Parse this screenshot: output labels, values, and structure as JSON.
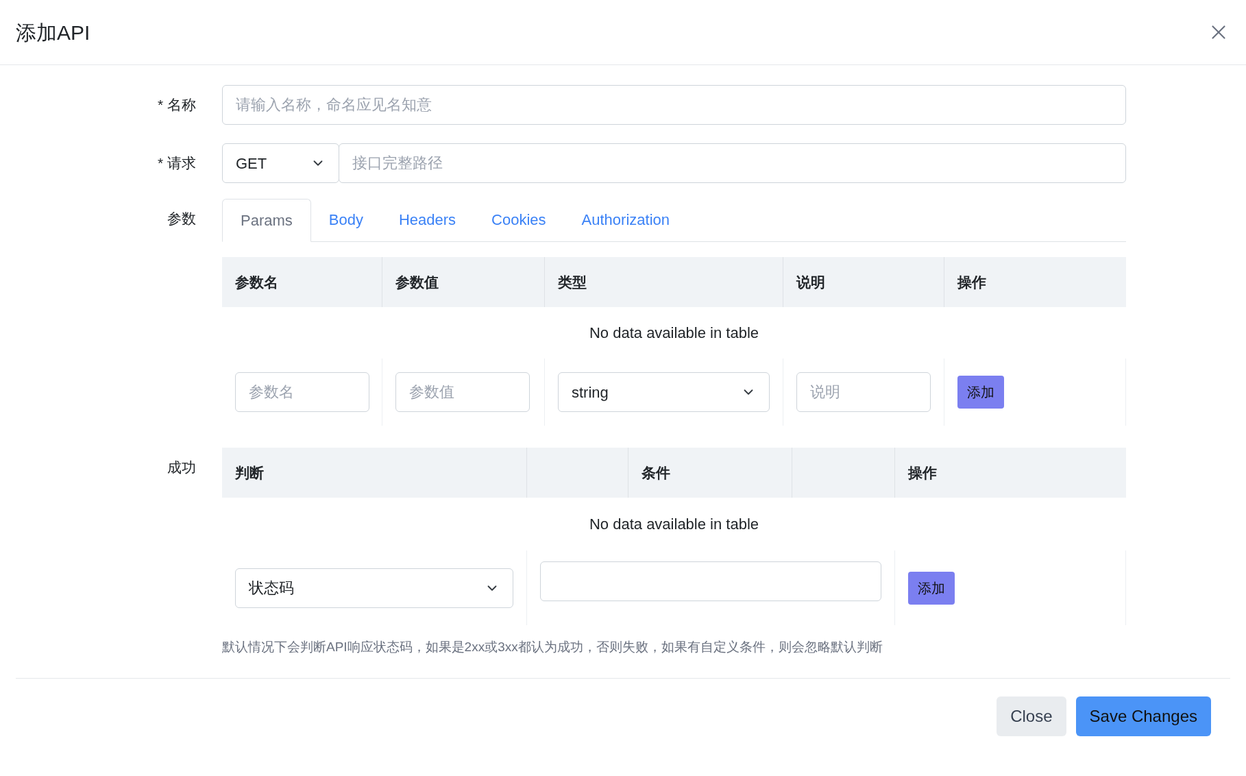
{
  "dialog": {
    "title": "添加API"
  },
  "form": {
    "name": {
      "label": "* 名称",
      "placeholder": "请输入名称，命名应见名知意"
    },
    "request": {
      "label": "* 请求",
      "method": "GET",
      "placeholder": "接口完整路径"
    },
    "params": {
      "label": "参数",
      "tabs": [
        {
          "label": "Params",
          "selected": true
        },
        {
          "label": "Body",
          "selected": false
        },
        {
          "label": "Headers",
          "selected": false
        },
        {
          "label": "Cookies",
          "selected": false
        },
        {
          "label": "Authorization",
          "selected": false
        }
      ],
      "columns": [
        "参数名",
        "参数值",
        "类型",
        "说明",
        "操作"
      ],
      "empty_text": "No data available in table",
      "new_row": {
        "name_placeholder": "参数名",
        "value_placeholder": "参数值",
        "type": "string",
        "desc_placeholder": "说明",
        "add": "添加"
      }
    },
    "success": {
      "label": "成功",
      "columns": [
        "判断",
        "条件",
        "操作"
      ],
      "empty_text": "No data available in table",
      "new_row": {
        "check": "状态码",
        "add": "添加"
      },
      "hint": "默认情况下会判断API响应状态码，如果是2xx或3xx都认为成功，否则失败，如果有自定义条件，则会忽略默认判断"
    }
  },
  "footer": {
    "buttons": [
      {
        "label": "Close",
        "kind": "secondary"
      },
      {
        "label": "Save Changes",
        "kind": "primary"
      }
    ]
  }
}
